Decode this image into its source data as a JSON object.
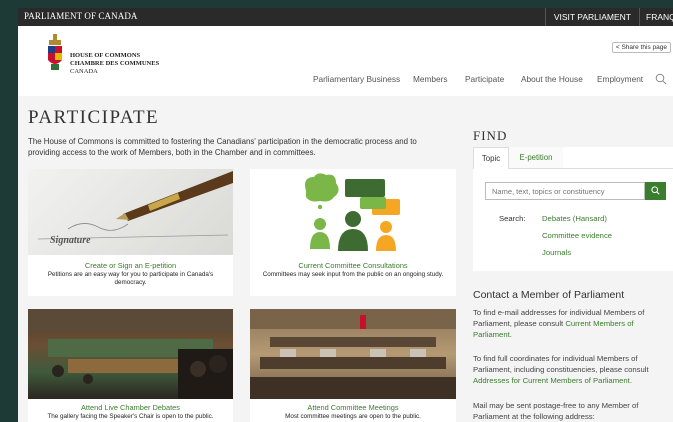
{
  "topbar": {
    "brand": "PARLIAMENT OF CANADA",
    "visit": "VISIT PARLIAMENT",
    "lang": "FRANÇAIS"
  },
  "logo": {
    "line1": "HOUSE OF COMMONS",
    "line2": "CHAMBRE DES COMMUNES",
    "line3": "CANADA"
  },
  "share": {
    "label": "Share this page",
    "icon": "share-icon"
  },
  "nav": [
    "Parliamentary Business",
    "Members",
    "Participate",
    "About the House",
    "Employment"
  ],
  "page": {
    "title": "PARTICIPATE",
    "intro": "The House of Commons is committed to fostering the Canadians' participation in the democratic process and to providing access to the work of Members, both in the Chamber and in committees."
  },
  "cards": [
    {
      "title": "Create or Sign an E-petition",
      "desc": "Petitions are an easy way for you to participate in Canada's democracy.",
      "img_text": "Signature"
    },
    {
      "title": "Current Committee Consultations",
      "desc": "Committees may seek input from the public on an ongoing study."
    },
    {
      "title": "Attend Live Chamber Debates",
      "desc": "The gallery facing the Speaker's Chair is open to the public."
    },
    {
      "title": "Attend Committee Meetings",
      "desc": "Most committee meetings are open to the public."
    }
  ],
  "find": {
    "title": "FIND",
    "tabs": [
      "Topic",
      "E-petition"
    ],
    "placeholder": "Name, text, topics or constituency",
    "search_label": "Search:",
    "links": [
      "Debates (Hansard)",
      "Committee evidence",
      "Journals"
    ]
  },
  "contact": {
    "title": "Contact a Member of Parliament",
    "p1_text": "To find e-mail addresses for individual Members of Parliament, please consult ",
    "p1_link": "Current Members of Parliament",
    "p1_end": ".",
    "p2_text": "To find full coordinates for individual Members of Parliament, including constituencies, please consult ",
    "p2_link": "Addresses for Current Members of Parliament",
    "p2_end": ".",
    "p3_text": "Mail may be sent postage-free to any Member of Parliament at the following address:"
  },
  "colors": {
    "accent": "#3a7d2c",
    "topbar": "#2a2a2a",
    "frame": "#1d3a36"
  }
}
